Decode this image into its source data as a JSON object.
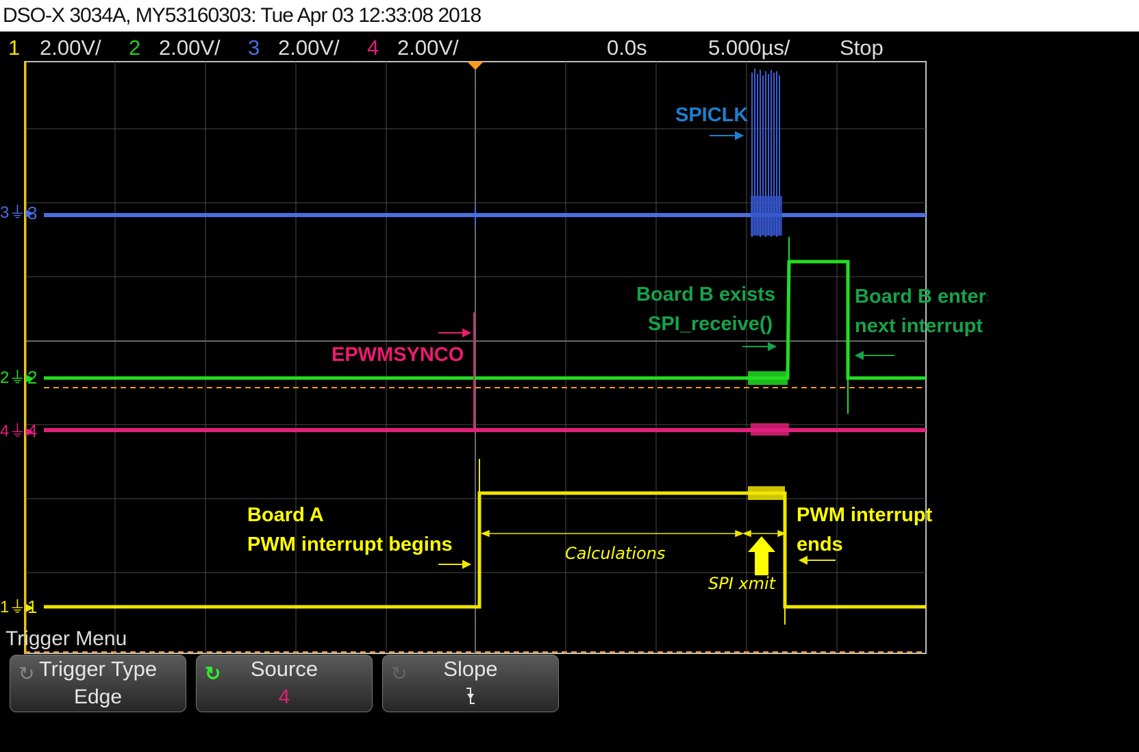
{
  "title": "DSO-X 3034A, MY53160303: Tue Apr 03 12:33:08 2018",
  "status": {
    "channels": [
      {
        "num": "1",
        "scale": "2.00V/",
        "color": "#f0e600"
      },
      {
        "num": "2",
        "scale": "2.00V/",
        "color": "#22cc22"
      },
      {
        "num": "3",
        "scale": "2.00V/",
        "color": "#4a6ee0"
      },
      {
        "num": "4",
        "scale": "2.00V/",
        "color": "#e0207a"
      }
    ],
    "delay": "0.0s",
    "timebase": "5.000µs/",
    "run_state": "Stop"
  },
  "traces": {
    "ch1": {
      "label": "1",
      "color": "#f0e600"
    },
    "ch2": {
      "label": "2",
      "color": "#22dd22"
    },
    "ch3": {
      "label": "3",
      "color": "#4a6ee0"
    },
    "ch4": {
      "label": "4",
      "color": "#e0207a"
    }
  },
  "annotations": {
    "spiclk": "SPICLK",
    "epwmsynco": "EPWMSYNCO",
    "board_b_exists_1": "Board B exists",
    "board_b_exists_2": "SPI_receive()",
    "board_b_enters_1": "Board B enters",
    "board_b_enters_2": "next interrupt",
    "board_a_1": "Board A",
    "board_a_2": "PWM interrupt begins",
    "pwm_ends_1": "PWM interrupt",
    "pwm_ends_2": "ends",
    "calculations": "Calculations",
    "spi_xmit": "SPI xmit"
  },
  "menu": {
    "title": "Trigger Menu",
    "softkeys": [
      {
        "label": "Trigger Type",
        "value": "Edge"
      },
      {
        "label": "Source",
        "value": "4"
      },
      {
        "label": "Slope",
        "value": "↚"
      }
    ]
  },
  "colors": {
    "annotation_blue": "#1e7fd0",
    "annotation_green": "#16a34a",
    "annotation_pink": "#ee1a70",
    "annotation_yellow": "#ffff00",
    "trigger_marker": "#ff9a1a"
  }
}
